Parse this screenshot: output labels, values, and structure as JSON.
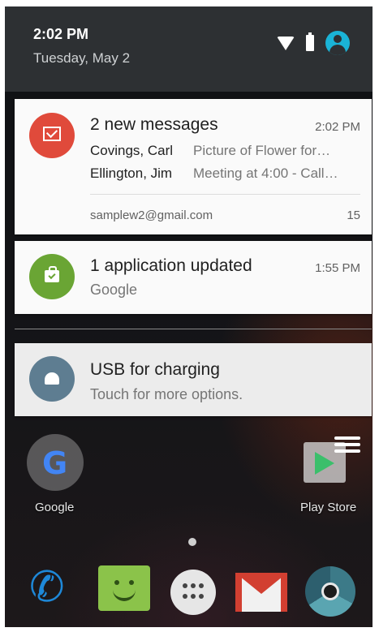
{
  "status": {
    "time": "2:02 PM",
    "date": "Tuesday, May 2",
    "icons": [
      "wifi-icon",
      "battery-icon",
      "account-icon"
    ]
  },
  "notifications": [
    {
      "app_icon": "gmail-icon",
      "title": "2 new messages",
      "time": "2:02 PM",
      "messages": [
        {
          "sender": "Covings, Carl",
          "preview": "Picture of Flower for…"
        },
        {
          "sender": "Ellington, Jim",
          "preview": "Meeting at 4:00 - Call…"
        }
      ],
      "account": "samplew2@gmail.com",
      "count": "15"
    },
    {
      "app_icon": "play-store-update-icon",
      "title": "1 application updated",
      "time": "1:55 PM",
      "subtitle": "Google"
    },
    {
      "app_icon": "android-icon",
      "title": "USB for charging",
      "subtitle": "Touch for more options."
    }
  ],
  "home": {
    "apps": [
      {
        "label": "Google"
      },
      {
        "label": "Play Store"
      }
    ],
    "dock": [
      "phone-icon",
      "messenger-icon",
      "app-drawer-icon",
      "gmail-icon",
      "camera-icon"
    ]
  }
}
